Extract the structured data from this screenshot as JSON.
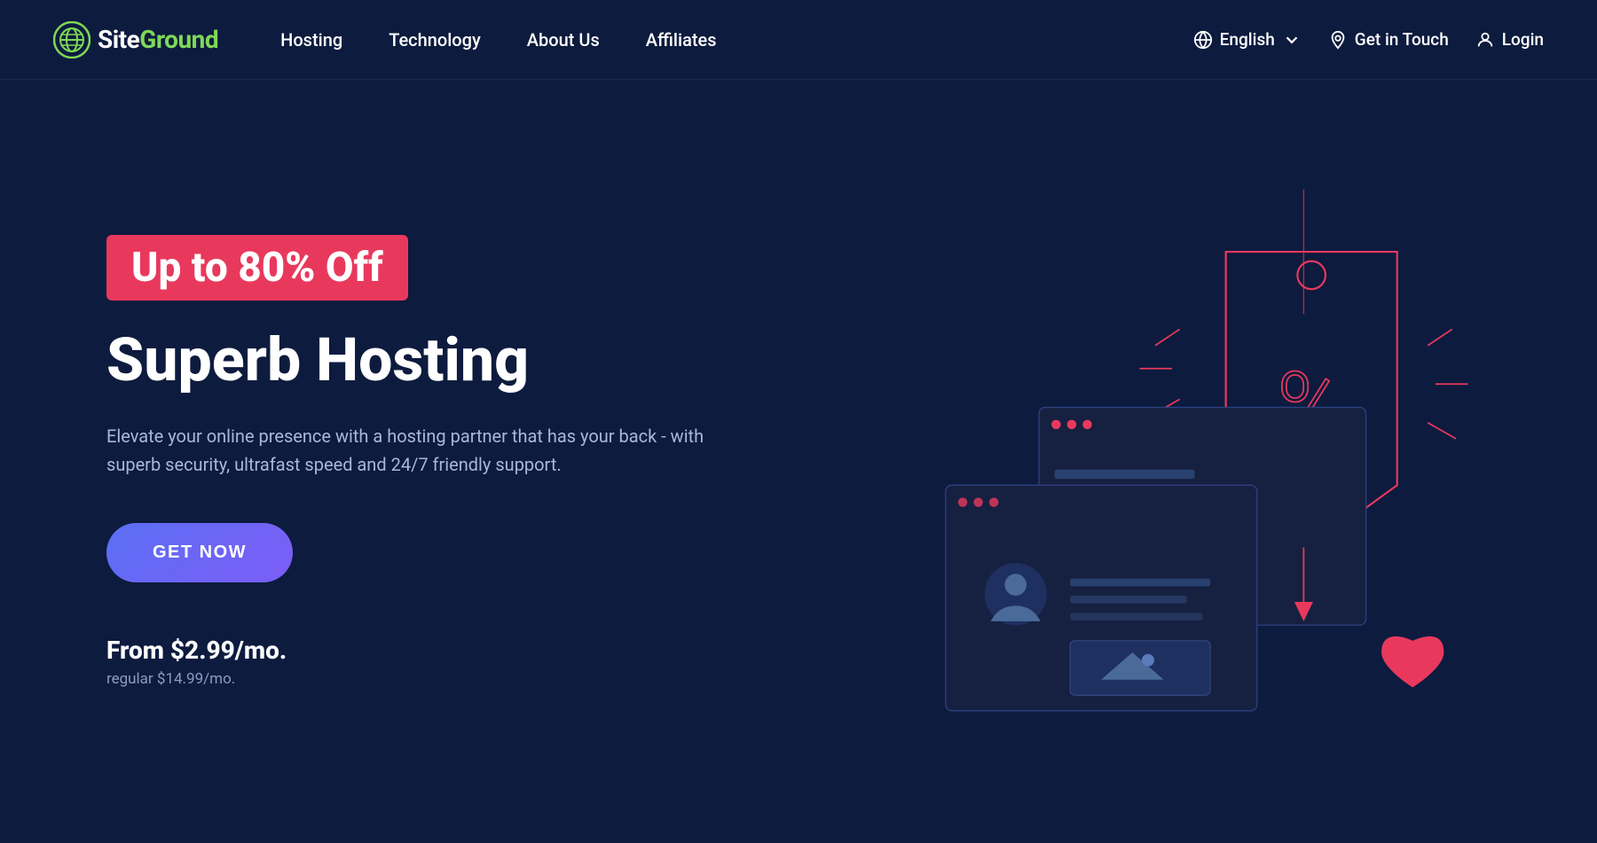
{
  "brand": {
    "name_prefix": "Site",
    "name_suffix": "Ground",
    "logo_alt": "SiteGround Logo"
  },
  "nav": {
    "links": [
      {
        "id": "hosting",
        "label": "Hosting"
      },
      {
        "id": "technology",
        "label": "Technology"
      },
      {
        "id": "about-us",
        "label": "About Us"
      },
      {
        "id": "affiliates",
        "label": "Affiliates"
      }
    ],
    "right": [
      {
        "id": "language",
        "label": "English",
        "icon": "language-icon",
        "hasChevron": true
      },
      {
        "id": "contact",
        "label": "Get in Touch",
        "icon": "location-icon"
      },
      {
        "id": "login",
        "label": "Login",
        "icon": "user-icon"
      }
    ]
  },
  "hero": {
    "badge": "Up to 80% Off",
    "title": "Superb Hosting",
    "description": "Elevate your online presence with a hosting partner that has your back - with superb security, ultrafast speed and 24/7 friendly support.",
    "cta_label": "GET NOW",
    "price_main": "From $2.99/mo.",
    "price_regular": "regular $14.99/mo."
  },
  "colors": {
    "bg": "#0d1b3e",
    "accent_pink": "#e8395d",
    "accent_purple": "#5b6ff5",
    "accent_green": "#7ed957",
    "text_muted": "#a8b8d8"
  }
}
